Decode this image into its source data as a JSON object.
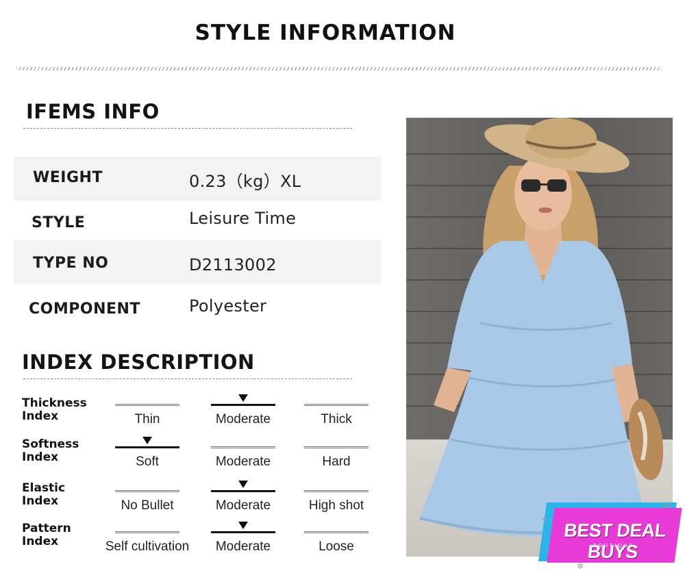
{
  "page": {
    "title": "STYLE INFORMATION"
  },
  "items_info": {
    "heading": "IFEMS INFO",
    "rows": [
      {
        "label": "WEIGHT",
        "value": "0.23（kg）XL"
      },
      {
        "label": "STYLE",
        "value": "Leisure Time"
      },
      {
        "label": "TYPE NO",
        "value": "D2113002"
      },
      {
        "label": "COMPONENT",
        "value": "Polyester"
      }
    ]
  },
  "index_description": {
    "heading": "INDEX DESCRIPTION",
    "indices": [
      {
        "label": "Thickness\nIndex",
        "options": [
          "Thin",
          "Moderate",
          "Thick"
        ],
        "selected_index": 1
      },
      {
        "label": "Softness\nIndex",
        "options": [
          "Soft",
          "Moderate",
          "Hard"
        ],
        "selected_index": 0
      },
      {
        "label": "Elastic\nIndex",
        "options": [
          "No Bullet",
          "Moderate",
          "High shot"
        ],
        "selected_index": 1
      },
      {
        "label": "Pattern\nIndex",
        "options": [
          "Self cultivation",
          "Moderate",
          "Loose"
        ],
        "selected_index": 1
      }
    ]
  },
  "badge": {
    "main": "BEST DEAL BUYS",
    "sub": "BOUTIQUE",
    "colors": {
      "front": "#e83ad6",
      "back": "#2ab5e8"
    }
  },
  "colors": {
    "dress": "#a9c8e6",
    "hat": "#d2b48a"
  }
}
